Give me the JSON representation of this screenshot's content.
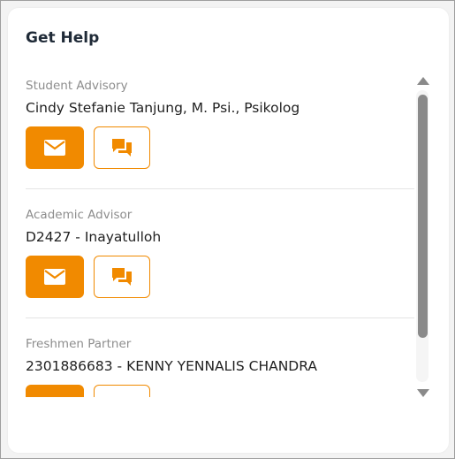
{
  "panel": {
    "title": "Get Help"
  },
  "contacts": [
    {
      "role": "Student Advisory",
      "name": "Cindy Stefanie Tanjung, M. Psi., Psikolog"
    },
    {
      "role": "Academic Advisor",
      "name": "D2427 - Inayatulloh"
    },
    {
      "role": "Freshmen Partner",
      "name": "2301886683 - KENNY YENNALIS CHANDRA"
    }
  ],
  "icons": {
    "email": "envelope-icon",
    "chat": "chat-bubbles-icon"
  },
  "colors": {
    "accent": "#f18a00",
    "title": "#1f2a37",
    "role_label": "#8d8d8d",
    "scrollbar": "#8a8a8a"
  }
}
